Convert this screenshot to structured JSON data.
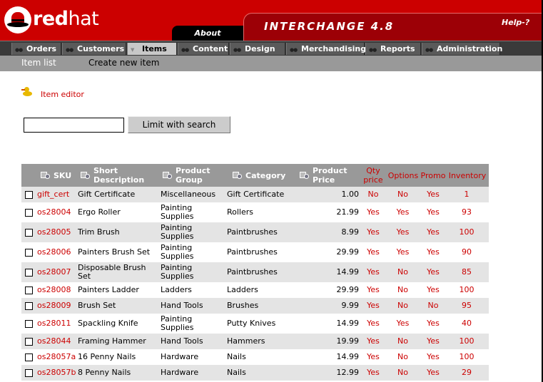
{
  "header": {
    "logo_part1": "red",
    "logo_part2": "hat",
    "about_tab": "About",
    "app_title": "INTERCHANGE 4.8",
    "help_link": "Help-?"
  },
  "nav": {
    "items": [
      {
        "label": "Orders"
      },
      {
        "label": "Customers"
      },
      {
        "label": "Items"
      },
      {
        "label": "Content"
      },
      {
        "label": "Design"
      },
      {
        "label": "Merchandising"
      },
      {
        "label": "Reports"
      },
      {
        "label": "Administration"
      }
    ],
    "active_index": 2
  },
  "subnav": {
    "item_list": "Item list",
    "create_new": "Create new item"
  },
  "editor": {
    "link": "Item editor"
  },
  "search": {
    "value": "",
    "button": "Limit with search"
  },
  "table": {
    "headers": {
      "sku": "SKU",
      "desc": "Short Description",
      "group": "Product Group",
      "category": "Category",
      "price": "Product Price",
      "qty": "Qty price",
      "options": "Options",
      "promo": "Promo",
      "inventory": "Inventory"
    },
    "rows": [
      {
        "sku": "gift_cert",
        "desc": "Gift Certificate",
        "group": "Miscellaneous",
        "category": "Gift Certificate",
        "price": "1.00",
        "qty": "No",
        "options": "No",
        "promo": "Yes",
        "inventory": "1"
      },
      {
        "sku": "os28004",
        "desc": "Ergo Roller",
        "group": "Painting Supplies",
        "category": "Rollers",
        "price": "21.99",
        "qty": "Yes",
        "options": "Yes",
        "promo": "Yes",
        "inventory": "93"
      },
      {
        "sku": "os28005",
        "desc": "Trim Brush",
        "group": "Painting Supplies",
        "category": "Paintbrushes",
        "price": "8.99",
        "qty": "Yes",
        "options": "Yes",
        "promo": "Yes",
        "inventory": "100"
      },
      {
        "sku": "os28006",
        "desc": "Painters Brush Set",
        "group": "Painting Supplies",
        "category": "Paintbrushes",
        "price": "29.99",
        "qty": "Yes",
        "options": "Yes",
        "promo": "Yes",
        "inventory": "90"
      },
      {
        "sku": "os28007",
        "desc": "Disposable Brush Set",
        "group": "Painting Supplies",
        "category": "Paintbrushes",
        "price": "14.99",
        "qty": "Yes",
        "options": "No",
        "promo": "Yes",
        "inventory": "85"
      },
      {
        "sku": "os28008",
        "desc": "Painters Ladder",
        "group": "Ladders",
        "category": "Ladders",
        "price": "29.99",
        "qty": "Yes",
        "options": "No",
        "promo": "Yes",
        "inventory": "100"
      },
      {
        "sku": "os28009",
        "desc": "Brush Set",
        "group": "Hand Tools",
        "category": "Brushes",
        "price": "9.99",
        "qty": "Yes",
        "options": "No",
        "promo": "No",
        "inventory": "95"
      },
      {
        "sku": "os28011",
        "desc": "Spackling Knife",
        "group": "Painting Supplies",
        "category": "Putty Knives",
        "price": "14.99",
        "qty": "Yes",
        "options": "Yes",
        "promo": "Yes",
        "inventory": "40"
      },
      {
        "sku": "os28044",
        "desc": "Framing Hammer",
        "group": "Hand Tools",
        "category": "Hammers",
        "price": "19.99",
        "qty": "Yes",
        "options": "No",
        "promo": "Yes",
        "inventory": "100"
      },
      {
        "sku": "os28057a",
        "desc": "16 Penny Nails",
        "group": "Hardware",
        "category": "Nails",
        "price": "14.99",
        "qty": "Yes",
        "options": "No",
        "promo": "Yes",
        "inventory": "100"
      },
      {
        "sku": "os28057b",
        "desc": "8 Penny Nails",
        "group": "Hardware",
        "category": "Nails",
        "price": "12.99",
        "qty": "Yes",
        "options": "No",
        "promo": "Yes",
        "inventory": "29"
      }
    ]
  },
  "colors": {
    "brand_red": "#cc0000",
    "dark_red": "#9c0006",
    "nav_bg": "#3a3a3a",
    "header_grey": "#999999",
    "row_alt": "#e4e4e4"
  }
}
